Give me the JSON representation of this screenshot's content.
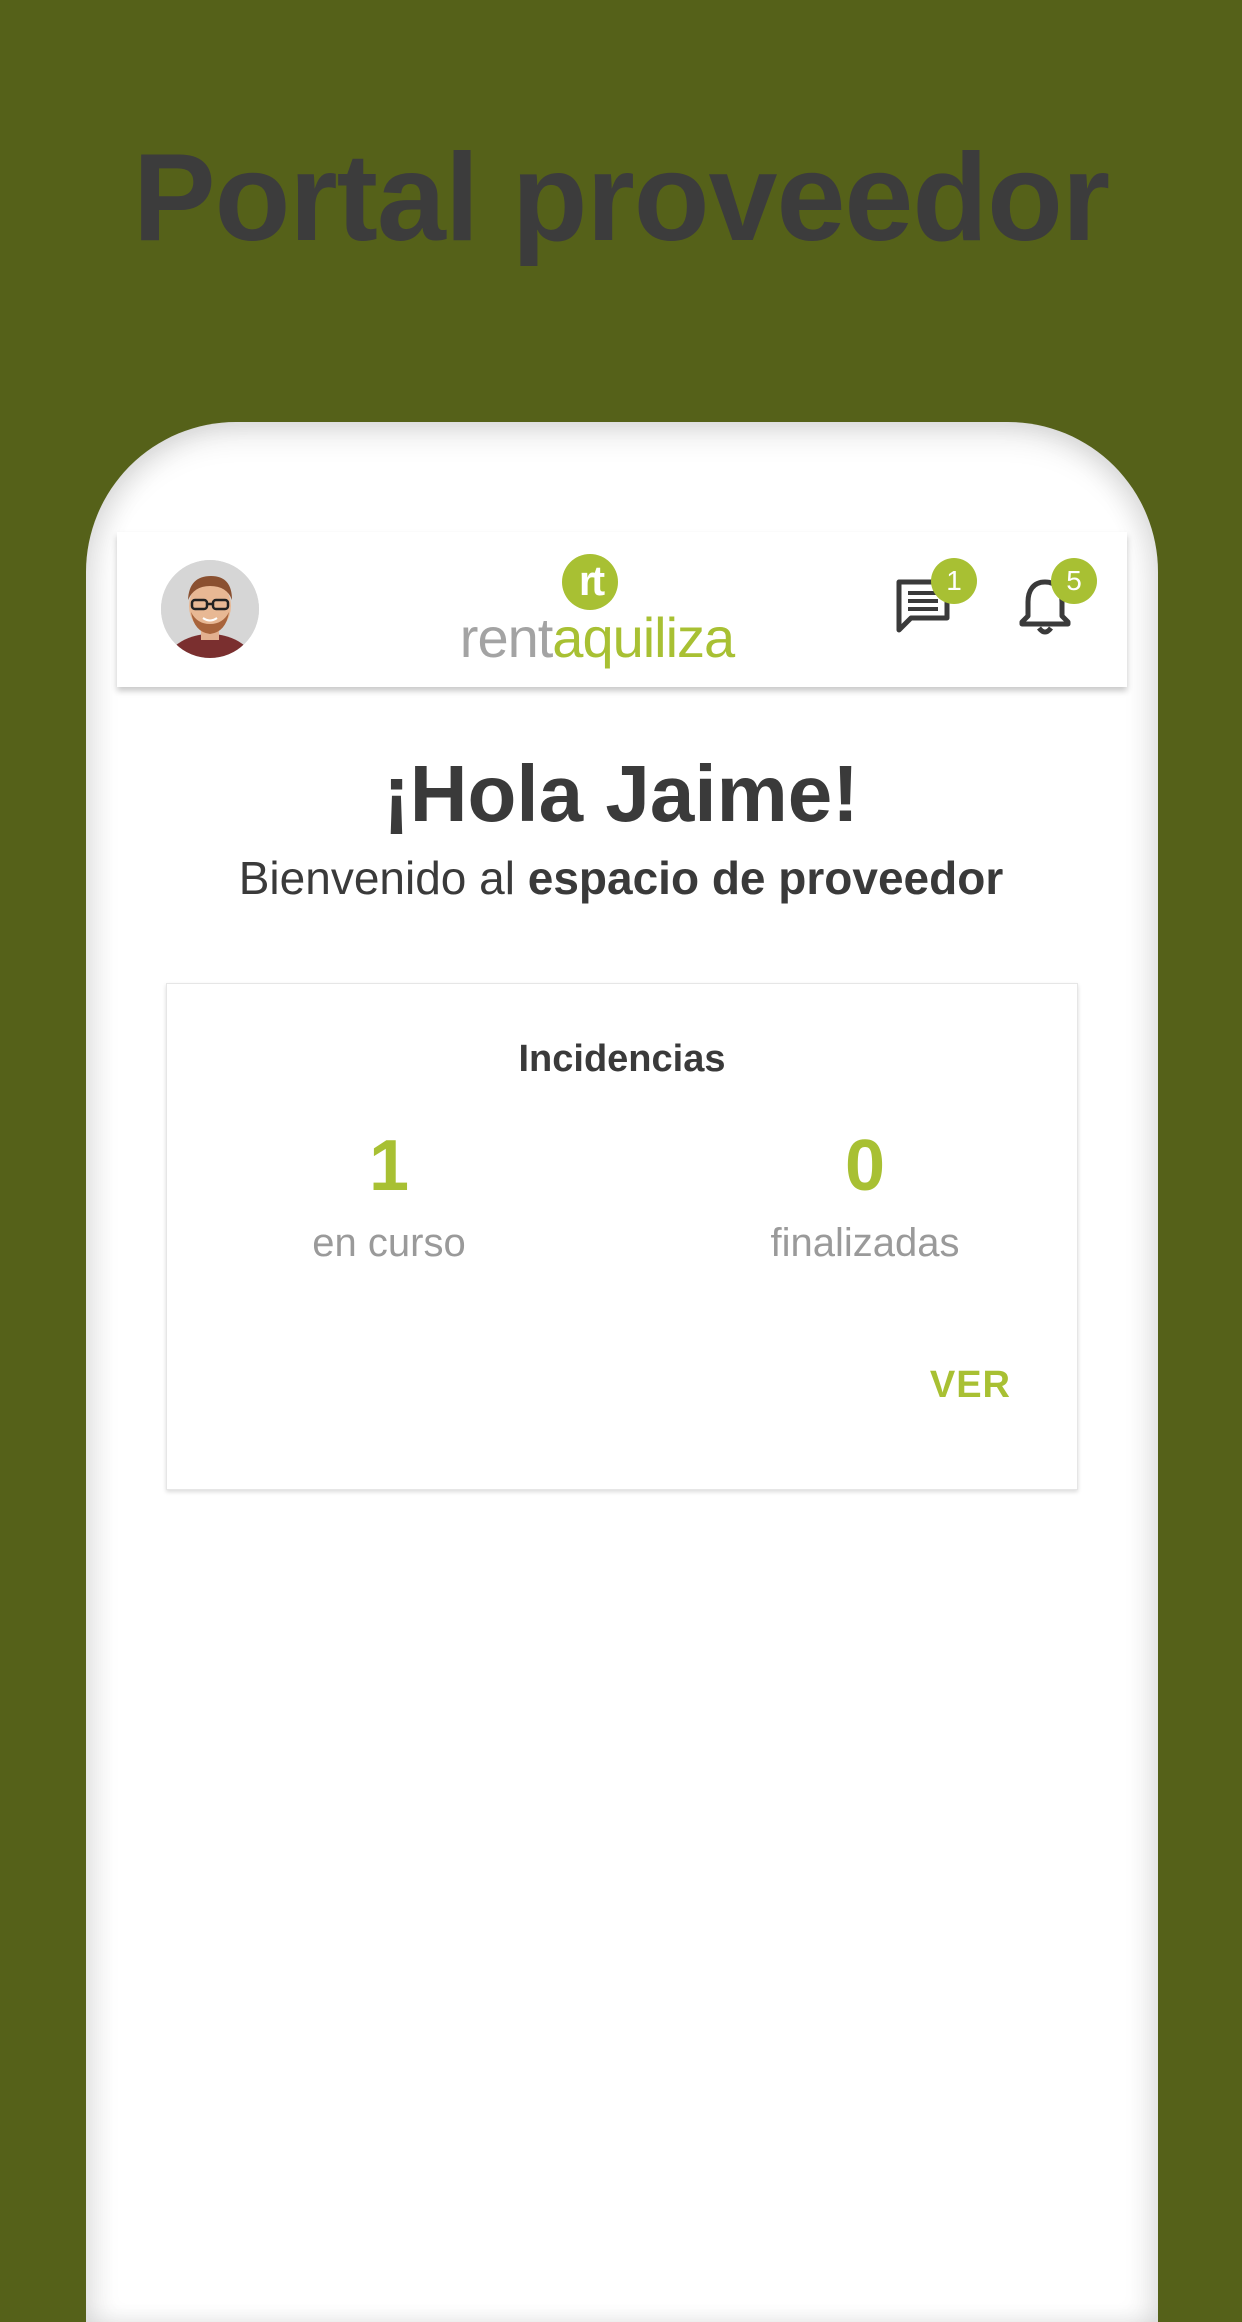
{
  "promo": {
    "title": "Portal proveedor"
  },
  "header": {
    "logo": {
      "mark": "rt",
      "word_grey": "rent",
      "word_green": "aquiliza"
    },
    "messages_badge": "1",
    "notifications_badge": "5"
  },
  "main": {
    "greeting": "¡Hola Jaime!",
    "welcome_prefix": "Bienvenido al ",
    "welcome_bold": "espacio de proveedor"
  },
  "incidencias_card": {
    "title": "Incidencias",
    "in_progress_count": "1",
    "in_progress_label": "en curso",
    "finished_count": "0",
    "finished_label": "finalizadas",
    "action_label": "VER"
  },
  "colors": {
    "background": "#556119",
    "accent": "#a8c033",
    "text_dark": "#3a3a3a",
    "text_muted": "#9a9a9a"
  },
  "icons": [
    "avatar",
    "logo-mark-icon",
    "message-icon",
    "bell-icon"
  ]
}
